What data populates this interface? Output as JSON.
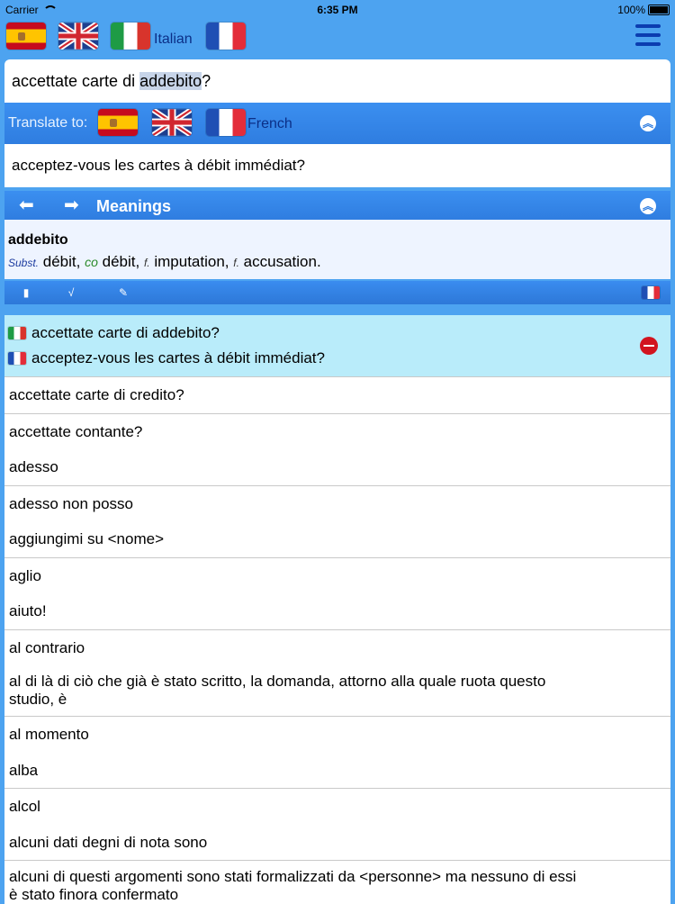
{
  "status": {
    "carrier": "Carrier",
    "time": "6:35 PM",
    "battery": "100%"
  },
  "header": {
    "source_lang": "Italian",
    "target_lang": "French",
    "flags": [
      "spanish-flag",
      "uk-flag",
      "italian-flag",
      "french-flag"
    ]
  },
  "input": {
    "prefix": "accettate carte di ",
    "highlight": "addebito",
    "suffix": "?"
  },
  "translate": {
    "label": "Translate to:"
  },
  "output": {
    "text": "acceptez-vous les cartes à débit immédiat?"
  },
  "meanings": {
    "label": "Meanings",
    "word": "addebito",
    "pos": "Subst.",
    "def1": "débit,",
    "co": "co",
    "def2": "débit,",
    "gen1": "f.",
    "def3": "imputation,",
    "gen2": "f.",
    "def4": "accusation."
  },
  "selected": {
    "source": "accettate carte di addebito?",
    "target": "acceptez-vous les cartes à débit immédiat?"
  },
  "list": [
    "accettate carte di credito?",
    "accettate contante?",
    "adesso",
    "adesso non posso",
    "aggiungimi su <nome>",
    "aglio",
    "aiuto!",
    "al contrario",
    "al di là di ciò che già è stato scritto, la domanda, attorno alla quale ruota questo",
    "studio, è",
    "al momento",
    "alba",
    "alcol",
    "alcuni dati degni di nota sono",
    "alcuni di questi argomenti sono stati formalizzati da <personne> ma nessuno di essi",
    "è stato finora confermato"
  ],
  "colors": {
    "background": "#4da3f0",
    "bar": "#2f7de0",
    "selected_row": "#b9ecfa",
    "remove": "#d2141f"
  }
}
